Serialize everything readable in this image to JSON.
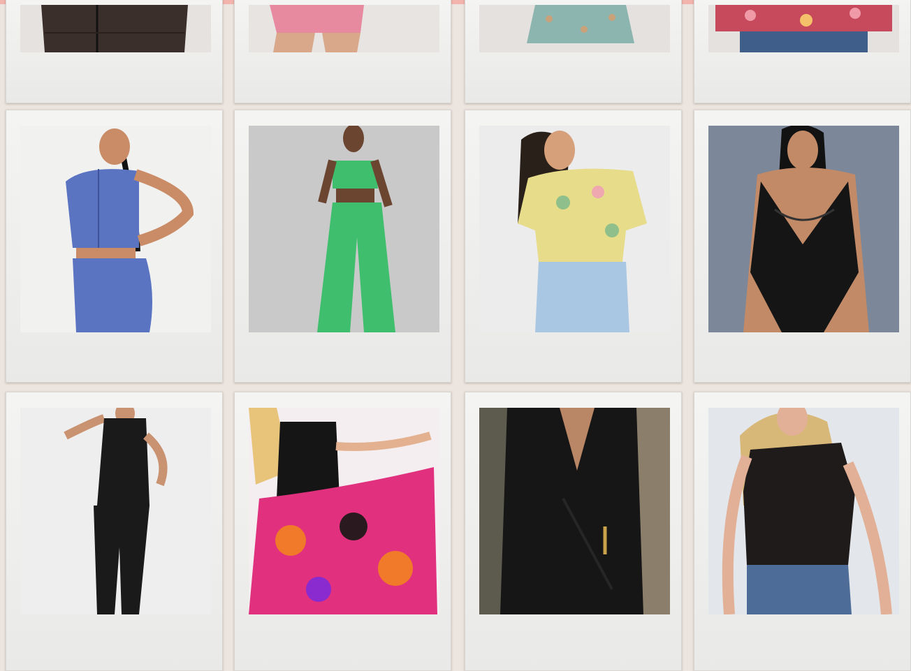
{
  "page": {
    "accent_color": "#f2b4ac",
    "background_color": "#ece4de",
    "card_color": "#f1f1f0"
  },
  "products": [
    {
      "row": 0,
      "col": 0,
      "name": "dark-puffer-jacket",
      "bg": "#e6e2df",
      "main": "#3a2f2a"
    },
    {
      "row": 0,
      "col": 1,
      "name": "pink-biker-shorts",
      "bg": "#e8e4e2",
      "main": "#e78aa0"
    },
    {
      "row": 0,
      "col": 2,
      "name": "floral-skirt",
      "bg": "#e4e1de",
      "main": "#8db5b0"
    },
    {
      "row": 0,
      "col": 3,
      "name": "floral-blouse",
      "bg": "#e5e1de",
      "main": "#c74a5c"
    },
    {
      "row": 1,
      "col": 0,
      "name": "blue-zip-crop-top-set",
      "bg": "#f1f1f0",
      "main": "#5a74c2"
    },
    {
      "row": 1,
      "col": 1,
      "name": "green-knit-crop-top-set",
      "bg": "#c9c9ca",
      "main": "#3fbf6d"
    },
    {
      "row": 1,
      "col": 2,
      "name": "yellow-floral-ruched-top",
      "bg": "#ececec",
      "main": "#e6dc8a"
    },
    {
      "row": 1,
      "col": 3,
      "name": "black-lace-bodysuit",
      "bg": "#7c8899",
      "main": "#151515"
    },
    {
      "row": 2,
      "col": 0,
      "name": "black-utility-jumpsuit",
      "bg": "#eeeeef",
      "main": "#1a1a1a"
    },
    {
      "row": 2,
      "col": 1,
      "name": "black-top-tropical-skirt",
      "bg": "#f4eef0",
      "main": "#e0307e"
    },
    {
      "row": 2,
      "col": 2,
      "name": "black-wrap-dress",
      "bg": "#5d5a4e",
      "main": "#161616"
    },
    {
      "row": 2,
      "col": 3,
      "name": "black-lace-peplum-top",
      "bg": "#e3e6ea",
      "main": "#1e1b1a"
    }
  ]
}
